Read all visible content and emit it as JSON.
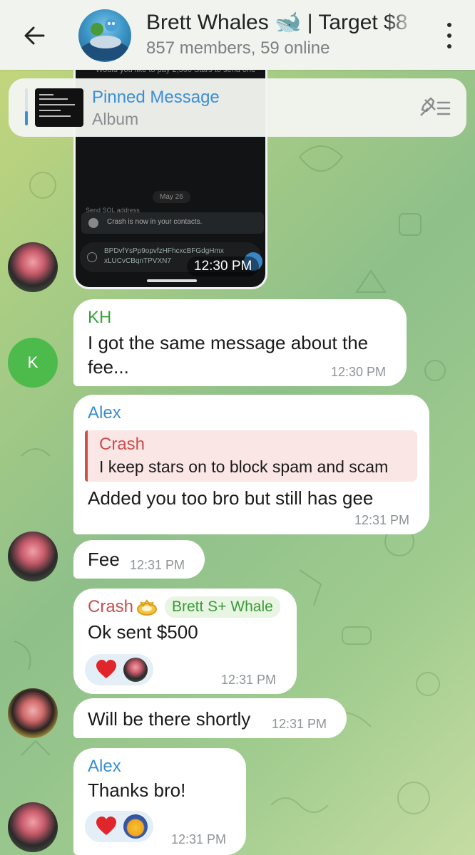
{
  "header": {
    "title": "Brett Whales 🐋 | Target $8",
    "subtitle": "857 members, 59 online"
  },
  "pinned": {
    "title": "Pinned Message",
    "subtitle": "Album"
  },
  "screenshot": {
    "top_text": "Would you like to pay 2,300 Stars to send one",
    "date": "May 26",
    "partial_label": "Send SOL address",
    "contact_notice": "Crash is now in your contacts.",
    "address_line1": "BPDvfYsPp9opvfzHFhcxcBFGdgHmx",
    "address_line2": "xLUCvCBqnTPVXN7",
    "time": "12:30 PM"
  },
  "messages": [
    {
      "sender": "KH",
      "avatar_letter": "K",
      "text": "I got the same message about the fee...",
      "time": "12:30 PM",
      "sender_color": "#3aa03a"
    },
    {
      "sender": "Alex",
      "quote_sender": "Crash",
      "quote_text": "I keep stars on to block spam and scam",
      "text": "Added you too bro but still has gee",
      "time": "12:31 PM",
      "sender_color": "#3a8ed0"
    },
    {
      "text": "Fee",
      "time": "12:31 PM"
    },
    {
      "sender": "Crash",
      "tag": "Brett S+ Whale",
      "text": "Ok sent $500",
      "time": "12:31 PM",
      "sender_color": "#c94f4f"
    },
    {
      "text": "Will be there shortly",
      "time": "12:31 PM"
    },
    {
      "sender": "Alex",
      "text": "Thanks bro!",
      "time": "12:31 PM",
      "sender_color": "#3a8ed0"
    }
  ],
  "icons": {
    "back": "arrow-left-icon",
    "menu": "more-vertical-icon",
    "pinned_list": "pinned-list-icon",
    "reaction": "heart-icon"
  }
}
